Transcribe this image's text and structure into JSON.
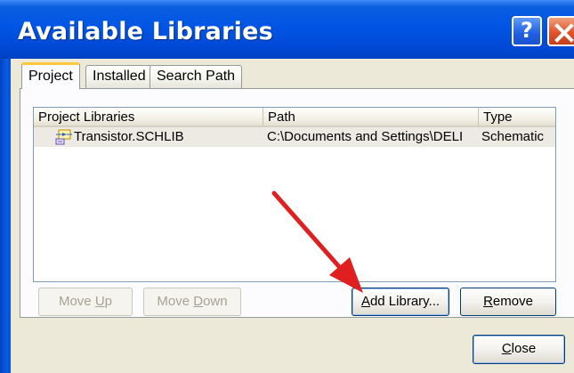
{
  "window": {
    "title": "Available Libraries",
    "help_glyph": "?"
  },
  "tabs": [
    {
      "label": "Project",
      "active": true
    },
    {
      "label": "Installed",
      "active": false
    },
    {
      "label": "Search Path",
      "active": false
    }
  ],
  "list": {
    "columns": [
      "Project Libraries",
      "Path",
      "Type"
    ],
    "rows": [
      {
        "name": "Transistor.SCHLIB",
        "path": "C:\\Documents and Settings\\DELI",
        "type": "Schematic",
        "icon": "schematic-library-icon"
      }
    ]
  },
  "buttons": {
    "move_up": {
      "label_pre": "Move ",
      "label_ul": "U",
      "label_post": "p",
      "enabled": false
    },
    "move_down": {
      "label_pre": "Move ",
      "label_ul": "D",
      "label_post": "own",
      "enabled": false
    },
    "add_library": {
      "label_pre": "",
      "label_ul": "A",
      "label_post": "dd Library...",
      "enabled": true
    },
    "remove": {
      "label_pre": "",
      "label_ul": "R",
      "label_post": "emove",
      "enabled": true
    },
    "close": {
      "label_pre": "",
      "label_ul": "C",
      "label_post": "lose",
      "enabled": true
    }
  },
  "colors": {
    "titlebar": "#0055e5",
    "close_button": "#e0532c",
    "annotation_arrow": "#e02020",
    "active_tab_highlight": "#ffc83c"
  }
}
